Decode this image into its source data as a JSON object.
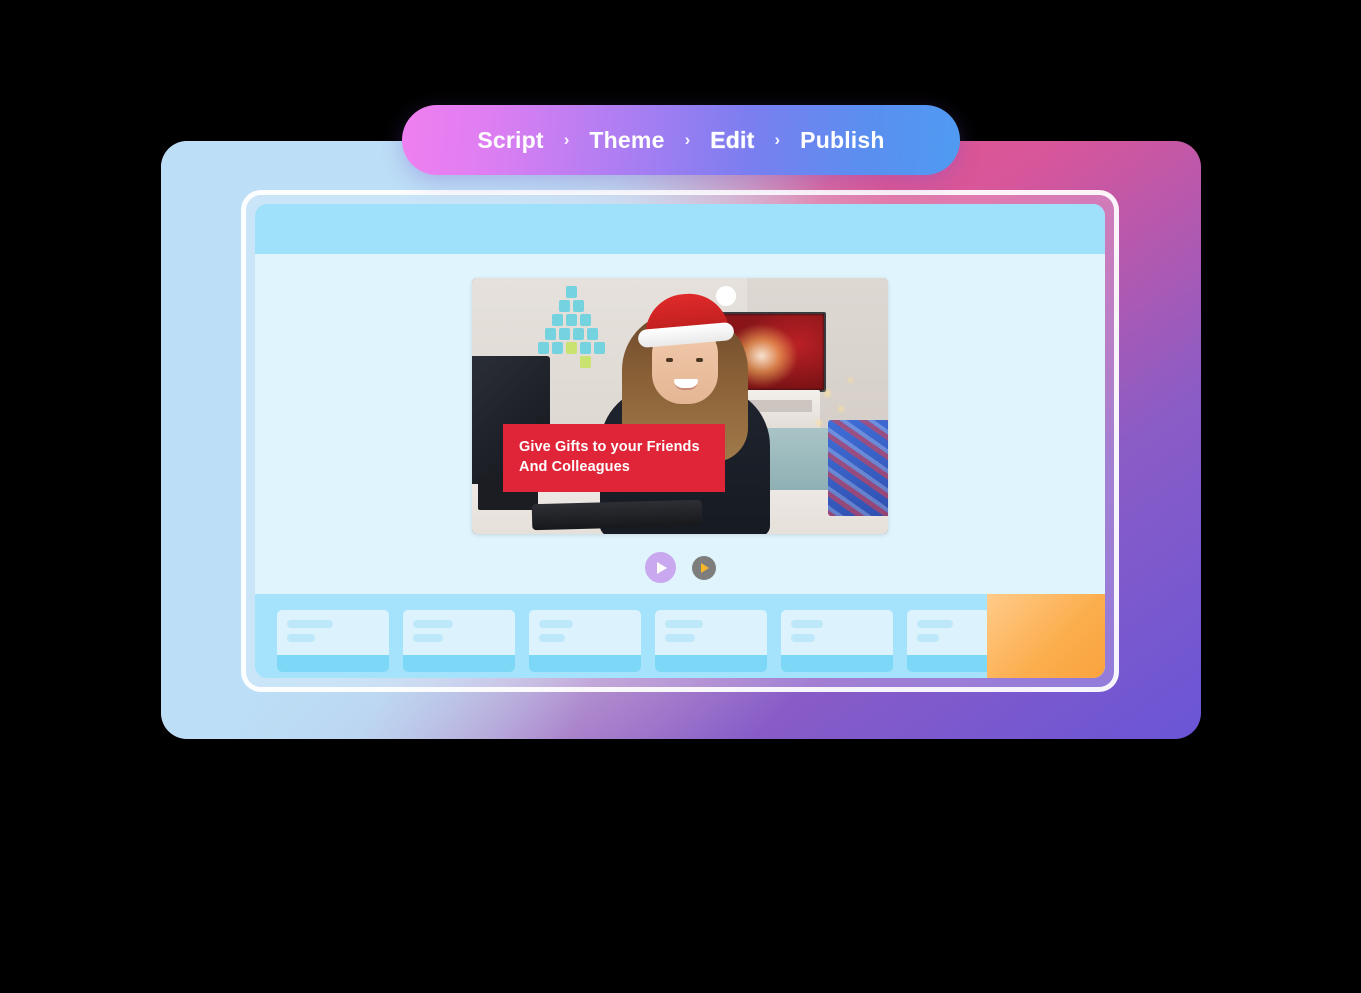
{
  "breadcrumb": {
    "separator": "›",
    "steps": [
      {
        "label": "Script",
        "active": false
      },
      {
        "label": "Theme",
        "active": false
      },
      {
        "label": "Edit",
        "active": true
      },
      {
        "label": "Publish",
        "active": false
      }
    ]
  },
  "app": {
    "header_color": "#9FE0FA",
    "canvas_color": "#E0F4FD",
    "frame_gradient": [
      "#B9DCF5",
      "#E8557F",
      "#6A55D6"
    ]
  },
  "preview": {
    "caption_text": "Give Gifts to your Friends And Colleagues",
    "caption_line1": "Give Gifts to your Friends",
    "caption_line2": "And Colleagues",
    "caption_bg": "#E02538",
    "caption_color": "#FFFFFF",
    "scene_description": "Woman wearing a Santa hat smiling at a desk with a monitor and keyboard, a TV showing a fireplace scene, a paper Christmas tree on the wall, and a wrapped gift box"
  },
  "controls": {
    "play_primary": {
      "icon": "play-icon",
      "color": "#C9A8F0",
      "glyph_color": "#FFFFFF"
    },
    "play_secondary": {
      "icon": "play-icon",
      "color": "#7E7E7E",
      "glyph_color": "#F5B828"
    }
  },
  "timeline": {
    "track_color": "#A5E2FB",
    "selection_color": "#FCAE4E",
    "clips": [
      {
        "bar1_width": 46,
        "bar2_width": 28
      },
      {
        "bar1_width": 40,
        "bar2_width": 30
      },
      {
        "bar1_width": 34,
        "bar2_width": 26
      },
      {
        "bar1_width": 38,
        "bar2_width": 30
      },
      {
        "bar1_width": 32,
        "bar2_width": 24
      },
      {
        "bar1_width": 36,
        "bar2_width": 22
      }
    ]
  }
}
